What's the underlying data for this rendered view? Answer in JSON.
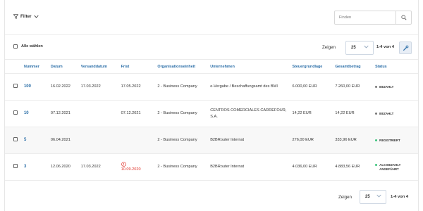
{
  "toolbar": {
    "filter_label": "Filter",
    "search_placeholder": "Finden"
  },
  "selection": {
    "select_all_label": "Alle wählen"
  },
  "paging": {
    "show_label": "Zeigen",
    "per_page": "25",
    "range": "1-4 von 4"
  },
  "table": {
    "columns": [
      "Nummer",
      "Datum",
      "Versanddatum",
      "Frist",
      "Organisationseinheit",
      "Unternehmen",
      "Steuergrundlage",
      "Gesamtbetrag",
      "Status"
    ],
    "rows": [
      {
        "number": "100",
        "date": "16.02.2022",
        "shipping_date": "17.03.2022",
        "deadline": "17.05.2022",
        "deadline_overdue": false,
        "org_unit": "2 - Business Company",
        "company": "e-Vergabe / Beschaffungsamt des BMI",
        "tax_base": "6.000,00 EUR",
        "total": "7.260,00 EUR",
        "status": "BEZAHLT",
        "status_color": "#777777"
      },
      {
        "number": "10",
        "date": "07.12.2021",
        "shipping_date": "",
        "deadline": "07.12.2021",
        "deadline_overdue": false,
        "org_unit": "2 - Business Company",
        "company": "CENTROS COMERCIALES CARREFOUR, S.A.",
        "tax_base": "14,22 EUR",
        "total": "14,22 EUR",
        "status": "BEZAHLT",
        "status_color": "#777777"
      },
      {
        "number": "5",
        "date": "06.04.2021",
        "shipping_date": "",
        "deadline": "",
        "deadline_overdue": false,
        "org_unit": "2 - Business Company",
        "company": "B2BRouter Internat",
        "tax_base": "276,00 EUR",
        "total": "333,96 EUR",
        "status": "REGISTRIERT",
        "status_color": "#3cc47c"
      },
      {
        "number": "3",
        "date": "12.06.2020",
        "shipping_date": "17.03.2022",
        "deadline": "10.09.2020",
        "deadline_overdue": true,
        "org_unit": "2 - Business Company",
        "company": "B2BRouter Internat",
        "tax_base": "4.036,00 EUR",
        "total": "4.883,56 EUR",
        "status": "ALS BEZAHLT ANGEFÜHRT",
        "status_color": "#3cc47c"
      }
    ]
  },
  "icons": {
    "filter": "filter-icon",
    "search": "search-icon",
    "chevron": "chevron-down-icon",
    "tools": "wrench-icon",
    "warning": "alert-circle-icon"
  },
  "colors": {
    "accent": "#2c6fa8",
    "danger": "#e0352b",
    "registered": "#3cc47c",
    "paid": "#777777"
  }
}
